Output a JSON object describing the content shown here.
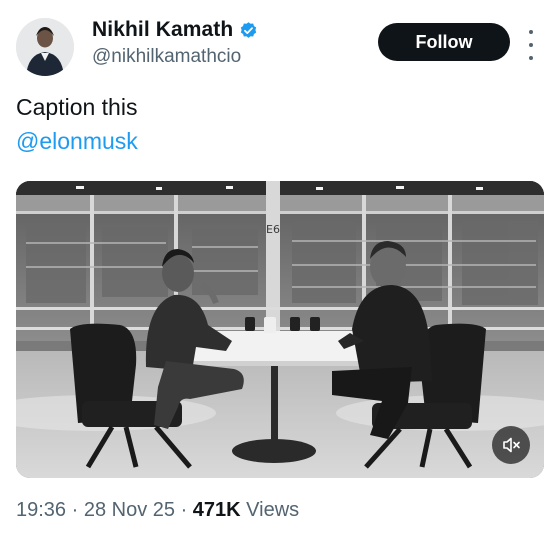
{
  "author": {
    "display_name": "Nikhil Kamath",
    "handle": "@nikhilkamathcio",
    "verified_icon": "verified-badge-icon",
    "verified_color": "#1d9bf0"
  },
  "actions": {
    "follow_label": "Follow",
    "more_icon": "more-vertical-icon"
  },
  "tweet": {
    "text_line1": "Caption this",
    "mention": "@elonmusk",
    "mention_color": "#1d9bf0"
  },
  "media": {
    "frame_label": "E6",
    "mute_icon": "speaker-muted-icon"
  },
  "meta": {
    "time": "19:36",
    "sep1": " · ",
    "date": "28 Nov 25",
    "sep2": " · ",
    "views_count": "471K",
    "views_label": " Views"
  },
  "colors": {
    "text": "#0f1419",
    "secondary": "#536471",
    "button_bg": "#0f1419",
    "button_text": "#ffffff"
  }
}
